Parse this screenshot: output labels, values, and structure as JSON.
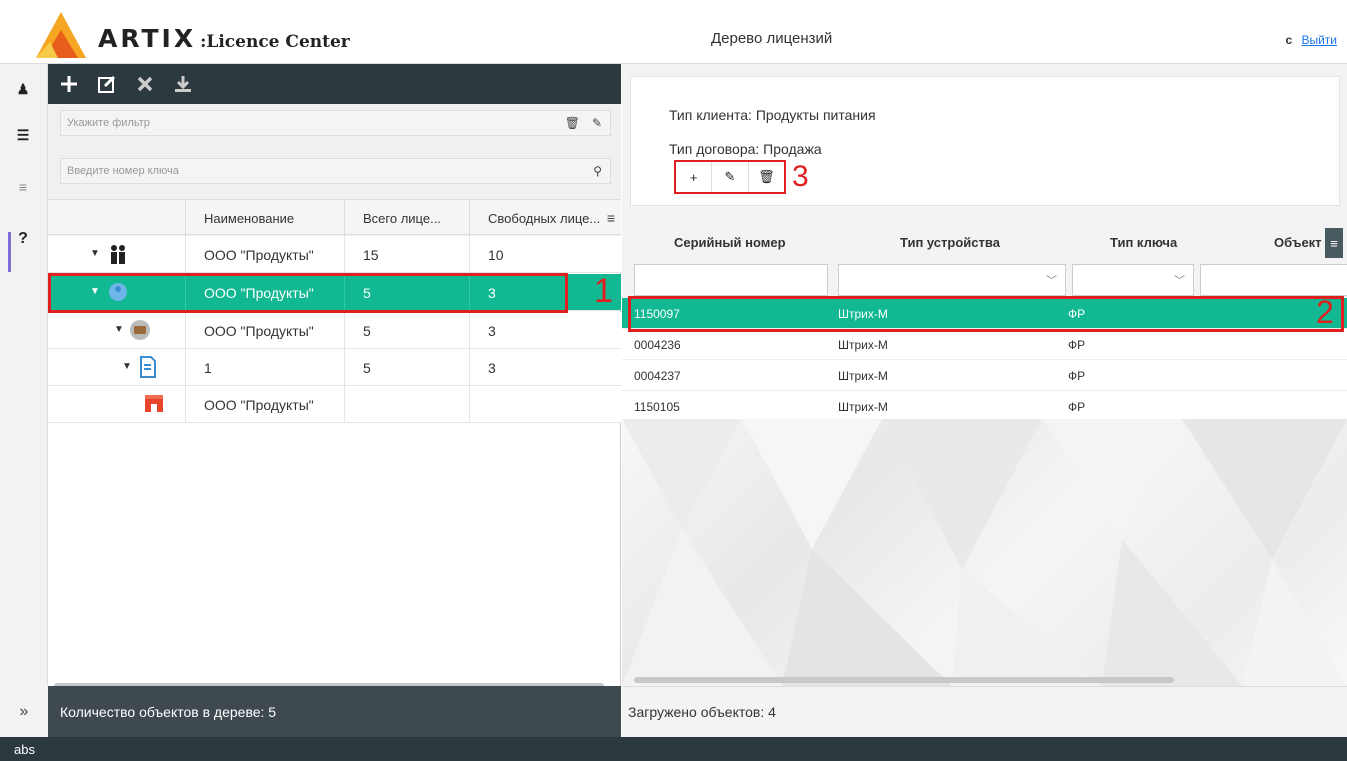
{
  "header": {
    "brand_artix": "ARTIX",
    "brand_suffix": ":Licence Center",
    "page_title": "Дерево лицензий",
    "user": "c",
    "logout": "Выйти"
  },
  "sidebar": {
    "items": [
      {
        "icon": "user-icon",
        "glyph": "♟"
      },
      {
        "icon": "tree-icon",
        "glyph": "☰"
      },
      {
        "icon": "list-icon",
        "glyph": "≡"
      },
      {
        "icon": "help-icon",
        "glyph": "?"
      }
    ],
    "expand": "»"
  },
  "left": {
    "filter_placeholder": "Укажите фильтр",
    "key_placeholder": "Введите номер ключа",
    "columns": [
      "Наименование",
      "Всего лице...",
      "Свободных лице..."
    ],
    "rows": [
      {
        "name": "ООО \"Продукты\"",
        "total": "15",
        "free": "10"
      },
      {
        "name": "ООО \"Продукты\"",
        "total": "5",
        "free": "3"
      },
      {
        "name": "ООО \"Продукты\"",
        "total": "5",
        "free": "3"
      },
      {
        "name": "1",
        "total": "5",
        "free": "3"
      },
      {
        "name": "ООО \"Продукты\"",
        "total": "",
        "free": ""
      }
    ],
    "status": "Количество объектов в дереве: 5",
    "marker": "1"
  },
  "right": {
    "client_type": "Тип клиента: Продукты питания",
    "contract_type": "Тип договора: Продажа",
    "btn_add": "+",
    "btn_edit": "✎",
    "btn_delete": "🗑",
    "marker_buttons": "3",
    "columns": [
      "Серийный номер",
      "Тип устройства",
      "Тип ключа",
      "Объект"
    ],
    "rows": [
      {
        "serial": "1150097",
        "device": "Штрих-М",
        "key": "ФР"
      },
      {
        "serial": "0004236",
        "device": "Штрих-М",
        "key": "ФР"
      },
      {
        "serial": "0004237",
        "device": "Штрих-М",
        "key": "ФР"
      },
      {
        "serial": "1150105",
        "device": "Штрих-М",
        "key": "ФР"
      }
    ],
    "marker_row": "2",
    "status": "Загружено объектов: 4"
  },
  "footer": {
    "text": "abs"
  },
  "colors": {
    "selected": "#12b891",
    "toolbar": "#2c3a40",
    "marker": "#e02020"
  }
}
